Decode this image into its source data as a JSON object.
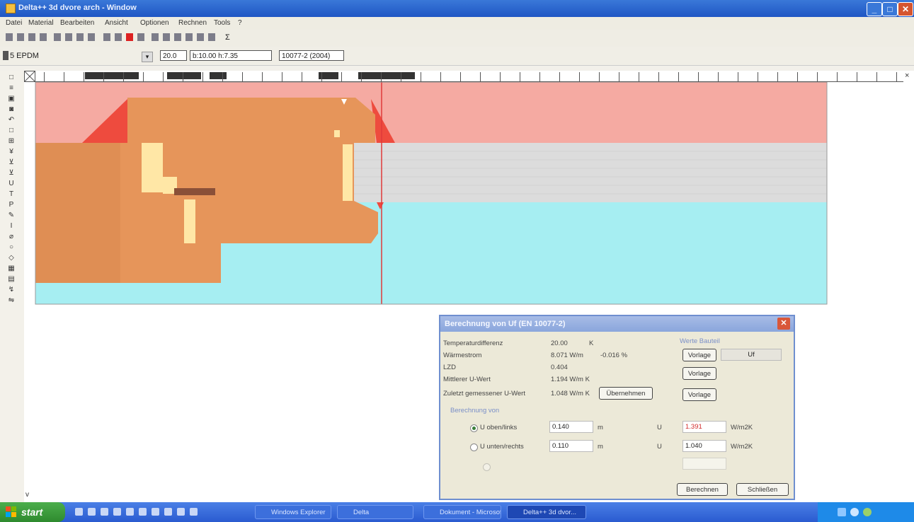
{
  "window": {
    "title": "Delta++ 3d dvore arch - Window",
    "btn_min": "_",
    "btn_max": "□",
    "btn_close": "✕"
  },
  "menu": [
    "Datei",
    "Material",
    "Bearbeiten",
    "Ansicht",
    "Optionen",
    "Rechnen",
    "Tools",
    "?"
  ],
  "toolbar": {
    "sigma": "Σ"
  },
  "material_row": {
    "material": "5 EPDM",
    "value": "20.0",
    "dims": "b:10.00  h:7.35",
    "norm": "10077-2 (2004)"
  },
  "left_tools": [
    "□",
    "≡",
    "▣",
    "◙",
    "↶",
    "□",
    "⊞",
    "¥",
    "⊻",
    "⊻",
    "U",
    "T",
    "P",
    "✎",
    "I",
    "⌀",
    "○",
    "◇",
    "▦",
    "▤",
    "↯",
    "⇋"
  ],
  "canvas": {
    "close_mark": "×",
    "scroll_mark": "v"
  },
  "dialog": {
    "title": "Berechnung von Uf (EN 10077-2)",
    "close": "✕",
    "temp_label": "Temperaturdifferenz",
    "temp_value": "20.00",
    "temp_unit": "K",
    "heat_label": "Wärmestrom",
    "heat_value": "8.071 W/m",
    "heat_dev": "-0.016 %",
    "lzd_label": "LZD",
    "lzd_value": "0.404",
    "u_mean_label": "Mittlerer U-Wert",
    "u_mean_value": "1.194 W/m K",
    "u_meas_label": "Zuletzt gemessener U-Wert",
    "u_meas_value": "1.048 W/m K",
    "btn_adopt": "Übernehmen",
    "ref_label": "Werte Bauteil",
    "btn_vorlage1": "Vorlage",
    "ref_value": "Uf",
    "btn_vorlage2": "Vorlage",
    "btn_vorlage3": "Vorlage",
    "section_label": "Berechnung von",
    "row1_label": "U oben/links",
    "row1_value": "0.140",
    "row1_unit": "m",
    "row1_u": "U",
    "row1_uval": "1.391",
    "row1_uunit": "W/m2K",
    "row2_label": "U unten/rechts",
    "row2_value": "0.110",
    "row2_unit": "m",
    "row2_u": "U",
    "row2_uval": "1.040",
    "row2_uunit": "W/m2K",
    "btn_calc": "Berechnen",
    "btn_close": "Schließen"
  },
  "taskbar": {
    "start": "start",
    "tasks": [
      "Windows Explorer",
      "Delta",
      "Dokument - Microsoft",
      "Delta++ 3d dvor..."
    ]
  }
}
